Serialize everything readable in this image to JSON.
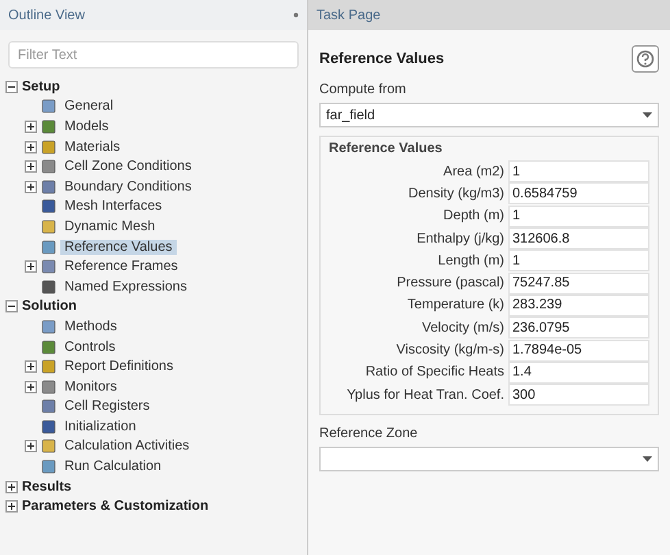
{
  "outline": {
    "title": "Outline View",
    "filter": {
      "placeholder": "Filter Text"
    },
    "tree": [
      {
        "label": "Setup",
        "expanded": true,
        "children": [
          {
            "label": "General",
            "kind": "leaf",
            "selected": false
          },
          {
            "label": "Models",
            "kind": "folder",
            "expanded": false,
            "selected": false
          },
          {
            "label": "Materials",
            "kind": "folder",
            "expanded": false,
            "selected": false
          },
          {
            "label": "Cell Zone Conditions",
            "kind": "folder",
            "expanded": false,
            "selected": false
          },
          {
            "label": "Boundary Conditions",
            "kind": "folder",
            "expanded": false,
            "selected": false
          },
          {
            "label": "Mesh Interfaces",
            "kind": "leaf",
            "selected": false
          },
          {
            "label": "Dynamic Mesh",
            "kind": "leaf",
            "selected": false
          },
          {
            "label": "Reference Values",
            "kind": "leaf",
            "selected": true
          },
          {
            "label": "Reference Frames",
            "kind": "folder",
            "expanded": false,
            "selected": false
          },
          {
            "label": "Named Expressions",
            "kind": "leaf",
            "selected": false
          }
        ]
      },
      {
        "label": "Solution",
        "expanded": true,
        "children": [
          {
            "label": "Methods",
            "kind": "leaf",
            "selected": false
          },
          {
            "label": "Controls",
            "kind": "leaf",
            "selected": false
          },
          {
            "label": "Report Definitions",
            "kind": "folder",
            "expanded": false,
            "selected": false
          },
          {
            "label": "Monitors",
            "kind": "folder",
            "expanded": false,
            "selected": false
          },
          {
            "label": "Cell Registers",
            "kind": "leaf",
            "selected": false
          },
          {
            "label": "Initialization",
            "kind": "leaf",
            "selected": false
          },
          {
            "label": "Calculation Activities",
            "kind": "folder",
            "expanded": false,
            "selected": false
          },
          {
            "label": "Run Calculation",
            "kind": "leaf",
            "selected": false
          }
        ]
      },
      {
        "label": "Results",
        "expanded": false
      },
      {
        "label": "Parameters & Customization",
        "expanded": false
      }
    ]
  },
  "task_page": {
    "title": "Task Page",
    "heading": "Reference Values",
    "compute_from": {
      "label": "Compute from",
      "value": "far_field"
    },
    "group_title": "Reference Values",
    "fields": [
      {
        "label": "Area (m2)",
        "value": "1"
      },
      {
        "label": "Density (kg/m3)",
        "value": "0.6584759"
      },
      {
        "label": "Depth (m)",
        "value": "1"
      },
      {
        "label": "Enthalpy (j/kg)",
        "value": "312606.8"
      },
      {
        "label": "Length (m)",
        "value": "1"
      },
      {
        "label": "Pressure (pascal)",
        "value": "75247.85"
      },
      {
        "label": "Temperature (k)",
        "value": "283.239"
      },
      {
        "label": "Velocity (m/s)",
        "value": "236.0795"
      },
      {
        "label": "Viscosity (kg/m-s)",
        "value": "1.7894e-05"
      },
      {
        "label": "Ratio of Specific Heats",
        "value": "1.4"
      },
      {
        "label": "Yplus for Heat Tran. Coef.",
        "value": "300"
      }
    ],
    "reference_zone": {
      "label": "Reference Zone"
    }
  }
}
